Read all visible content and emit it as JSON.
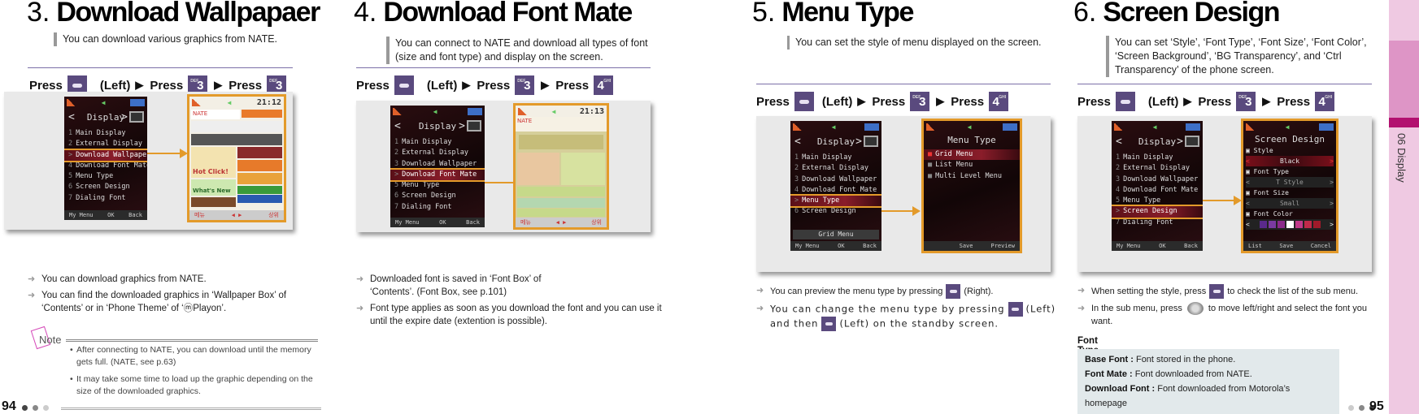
{
  "page_left": {
    "number": "94",
    "sections": [
      {
        "id": "s3",
        "num": "3.",
        "title": "Download Wallpapaer",
        "intro": "You can download various graphics from NATE.",
        "press": {
          "word": "Press",
          "left_label": "(Left)",
          "steps": [
            "soft-left-key",
            "key-3",
            "key-3"
          ]
        },
        "bullets": [
          "You can download graphics from NATE.",
          "You can find the downloaded graphics in ‘Wallpaper Box’ of ‘Contents’ or in ‘Phone Theme’ of ‘ⓜPlayon’."
        ],
        "note": {
          "label": "Note",
          "items": [
            "After connecting to NATE, you can download until the memory gets full. (NATE, see p.63)",
            "It may take some time to load up the graphic depending on the size of the downloaded graphics."
          ]
        }
      },
      {
        "id": "s4",
        "num": "4.",
        "title": "Download Font Mate",
        "intro": "You can connect to NATE and download all types of font (size and font type) and display on the screen.",
        "press": {
          "word": "Press",
          "left_label": "(Left)",
          "steps": [
            "soft-left-key",
            "key-3",
            "key-4"
          ]
        },
        "bullets": [
          "Downloaded font is saved in ‘Font Box’ of ‘Contents’. (Font Box, see p.101)",
          "Font type applies as soon as you download the font and you can use it until the expire date (extention is possible)."
        ]
      }
    ]
  },
  "page_right": {
    "number": "95",
    "sections": [
      {
        "id": "s5",
        "num": "5.",
        "title": "Menu Type",
        "intro": "You can set the style of menu displayed on the screen.",
        "press": {
          "word": "Press",
          "left_label": "(Left)",
          "steps": [
            "soft-left-key",
            "key-3",
            "key-4"
          ]
        },
        "bullets": [
          {
            "before": "You can preview the menu type by pressing",
            "after": "(Right)."
          },
          {
            "before": "You can change the menu type by pressing",
            "mid": "(Left) and then",
            "after": "(Left) on the standby screen."
          }
        ]
      },
      {
        "id": "s6",
        "num": "6.",
        "title": "Screen Design",
        "intro": "You can set ‘Style’, ‘Font Type’, ‘Font Size’, ‘Font Color’, ‘Screen Background’, ‘BG Transparency’, and ‘Ctrl Transparency’ of the phone screen.",
        "press": {
          "word": "Press",
          "left_label": "(Left)",
          "steps": [
            "soft-left-key",
            "key-3",
            "key-4"
          ]
        },
        "bullets": [
          {
            "before": "When setting the style, press",
            "after": "to check the list of the sub menu."
          },
          {
            "before": "In the sub menu, press",
            "after": "to move left/right and select the font you want."
          }
        ],
        "font_type": {
          "title": "Font Type",
          "rows": [
            {
              "term": "Base Font :",
              "desc": "Font stored in the phone."
            },
            {
              "term": "Font Mate :",
              "desc": "Font downloaded from NATE."
            },
            {
              "term": "Download Font :",
              "desc": "Font downloaded from Motorola’s homepage"
            }
          ]
        }
      }
    ]
  },
  "keys": {
    "key3_big": "3",
    "key3_small": "DEF",
    "key4_big": "4",
    "key4_small": "GHI"
  },
  "phone_display_menu": {
    "title": "Display",
    "items": [
      {
        "n": "1",
        "label": "Main Display"
      },
      {
        "n": "2",
        "label": "External Display"
      },
      {
        "n": "3",
        "label": "Download Wallpaper"
      },
      {
        "n": "4",
        "label": "Download Font Mate"
      },
      {
        "n": "5",
        "label": "Menu Type"
      },
      {
        "n": "6",
        "label": "Screen Design"
      },
      {
        "n": "7",
        "label": "Dialing Font"
      }
    ],
    "softkeys": [
      "My Menu",
      "OK",
      "Back"
    ],
    "grid_menu_bar": "Grid Menu"
  },
  "phone_nate": {
    "time1": "21:12",
    "time2": "21:13",
    "soft_left": "메뉴",
    "soft_right": "상위",
    "hot": "Hot Click!",
    "new": "What's New"
  },
  "phone_menu_type": {
    "title": "Menu Type",
    "options": [
      "Grid Menu",
      "List Menu",
      "Multi Level Menu"
    ],
    "softkeys": [
      "Save",
      "Preview"
    ]
  },
  "phone_screen_design": {
    "title": "Screen Design",
    "settings": [
      {
        "label": "Style",
        "value": "Black"
      },
      {
        "label": "Font Type",
        "value": "T Style"
      },
      {
        "label": "Font Size",
        "value": "Small"
      },
      {
        "label": "Font Color",
        "value": ""
      }
    ],
    "font_colors": [
      "#5a2a8c",
      "#7a3aa0",
      "#8a2a8a",
      "#ffffff",
      "#c03a8a",
      "#c02a4a",
      "#a01a2a"
    ],
    "softkeys": [
      "List",
      "Save",
      "Cancel"
    ]
  },
  "sidebar": {
    "chapter": "06 Display"
  },
  "colors": {
    "accent_purple": "#5a4a7e",
    "highlight_orange": "#e39a2a",
    "sidebar_pink": "#efc9e2",
    "sidebar_magenta": "#b2106f"
  }
}
